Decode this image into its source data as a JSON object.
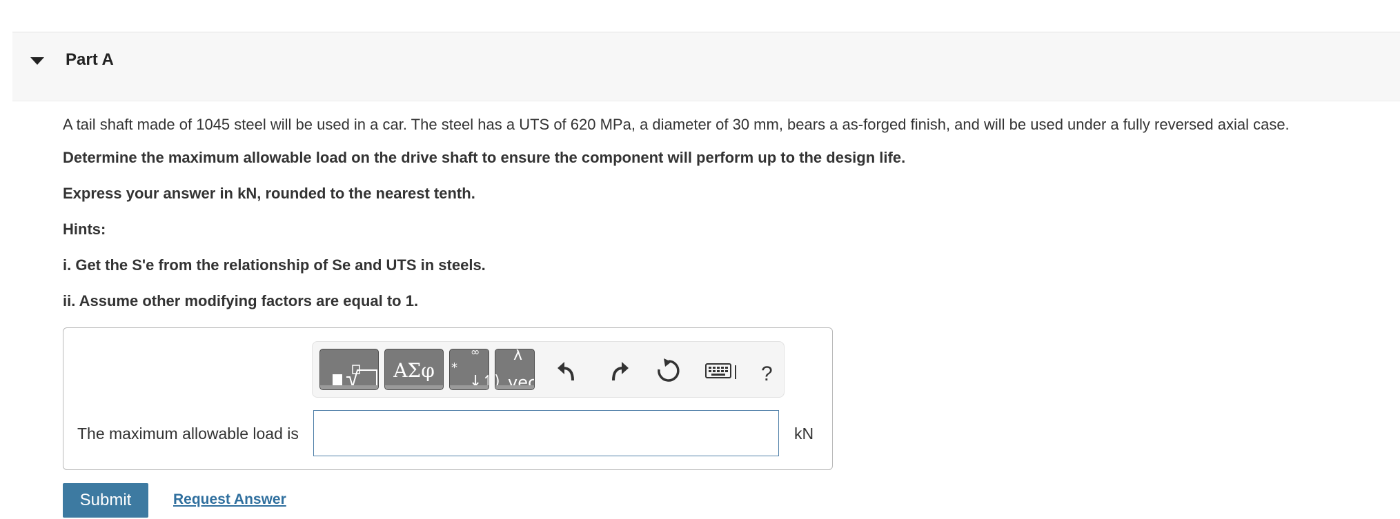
{
  "part": {
    "title": "Part A"
  },
  "question": {
    "intro": "A tail shaft made of 1045 steel will be used in a car. The steel has a UTS of 620 MPa, a diameter of 30 mm, bears a as-forged  finish, and will be used under a fully reversed axial case.",
    "task": "Determine the maximum allowable load on the drive shaft to ensure the component will perform up to the design life.",
    "instruction": "Express your answer in kN, rounded to the nearest tenth.",
    "hints_heading": "Hints:",
    "hint_1": "i. Get the S'e from the relationship of Se and UTS in steels.",
    "hint_2": "ii. Assume other modifying factors are equal to 1."
  },
  "toolbar": {
    "templates_icon": "fraction-sqrt-icon",
    "greek_label": "ΑΣφ",
    "arrows_label": "↓↑",
    "vector_label": "vec",
    "undo_icon": "undo-icon",
    "redo_icon": "redo-icon",
    "reset_icon": "reset-icon",
    "keyboard_icon": "keyboard-icon",
    "help_label": "?"
  },
  "answer": {
    "label": "The maximum allowable load is",
    "value": "",
    "unit": "kN"
  },
  "actions": {
    "submit_label": "Submit",
    "request_label": "Request Answer"
  },
  "colors": {
    "submit_bg": "#3d7aa1",
    "link": "#2f6f9e",
    "input_border": "#4f7fa8"
  }
}
